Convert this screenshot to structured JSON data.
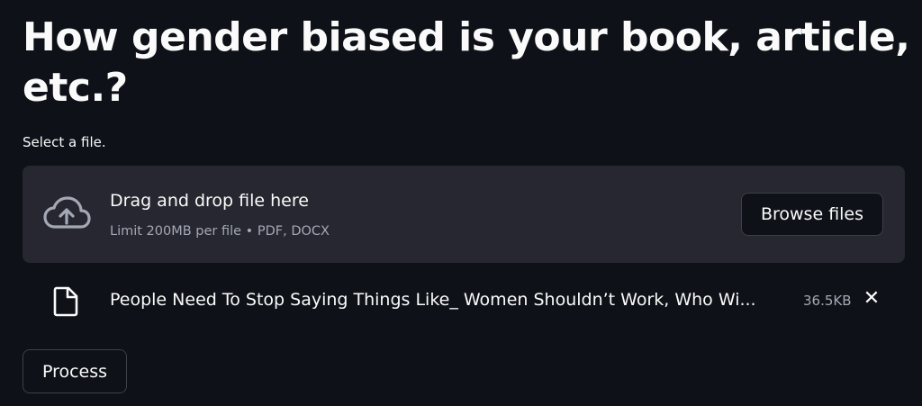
{
  "header": {
    "title": "How gender biased is your book, article, etc.?"
  },
  "uploader": {
    "label": "Select a file.",
    "dropzone_title": "Drag and drop file here",
    "dropzone_subtitle": "Limit 200MB per file • PDF, DOCX",
    "browse_label": "Browse files",
    "icon": "cloud-upload-icon"
  },
  "file": {
    "icon": "file-icon",
    "name": "People Need To Stop Saying Things Like_ Women Shouldn’t Work, Who Wi...",
    "size": "36.5KB",
    "remove_icon": "close-icon",
    "remove_glyph": "✕"
  },
  "actions": {
    "process_label": "Process"
  },
  "colors": {
    "background": "#0e1117",
    "dropzone": "#262730",
    "text": "#fafafa",
    "muted_text": "#a3a8b4",
    "button_border": "#3d4049"
  }
}
